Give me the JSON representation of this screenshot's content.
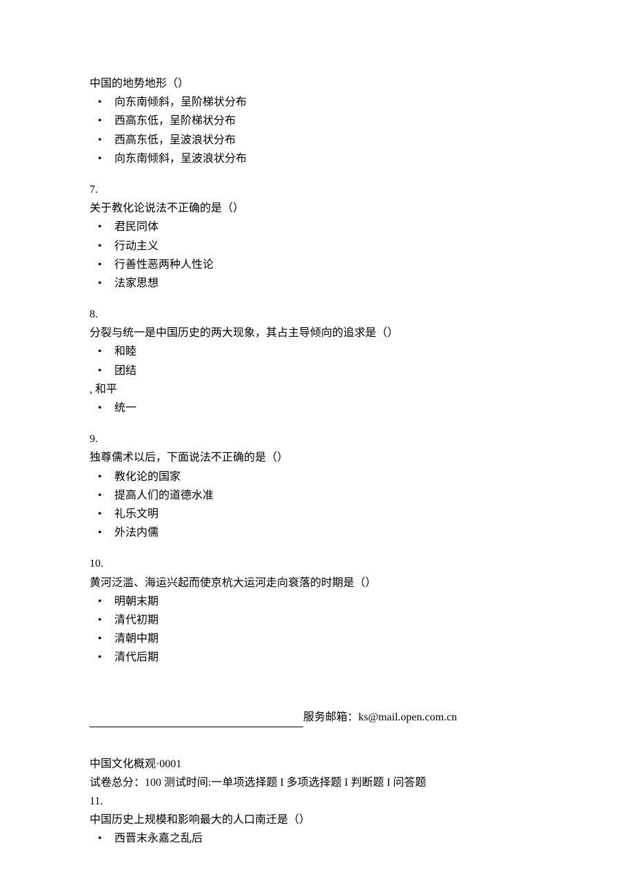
{
  "q6": {
    "stem": "中国的地势地形（）",
    "options": [
      "向东南倾斜，呈阶梯状分布",
      "西高东低，呈阶梯状分布",
      "西高东低，呈波浪状分布",
      "向东南倾斜，呈波浪状分布"
    ]
  },
  "q7": {
    "number": "7.",
    "stem": "关于教化论说法不正确的是（）",
    "options": [
      "君民同体",
      "行动主义",
      "行善性恶两种人性论",
      "法家思想"
    ]
  },
  "q8": {
    "number": "8.",
    "stem": "分裂与统一是中国历史的两大现象，其占主导倾向的追求是（）",
    "options_a": [
      "和睦",
      "团结"
    ],
    "inline": ", 和平",
    "options_b": [
      "统一"
    ]
  },
  "q9": {
    "number": "9.",
    "stem": "独尊儒术以后，下面说法不正确的是（）",
    "options": [
      "教化论的国家",
      "提高人们的道德水准",
      "礼乐文明",
      "外法内儒"
    ]
  },
  "q10": {
    "number": "10.",
    "stem": "黄河泛滥、海运兴起而使京杭大运河走向衰落的时期是（）",
    "options": [
      "明朝末期",
      "清代初期",
      "清朝中期",
      "清代后期"
    ]
  },
  "footer": {
    "label": "服务邮箱：",
    "email": "ks@mail.open.com.cn"
  },
  "header": {
    "title": "中国文化概观·0001",
    "subtitle": "试卷总分：100 测试时间:一单项选择题 I 多项选择题 I 判断题 I 问答题"
  },
  "q11": {
    "number": "11.",
    "stem": "中国历史上规模和影响最大的人口南迁是（）",
    "options": [
      "西晋末永嘉之乱后"
    ]
  }
}
